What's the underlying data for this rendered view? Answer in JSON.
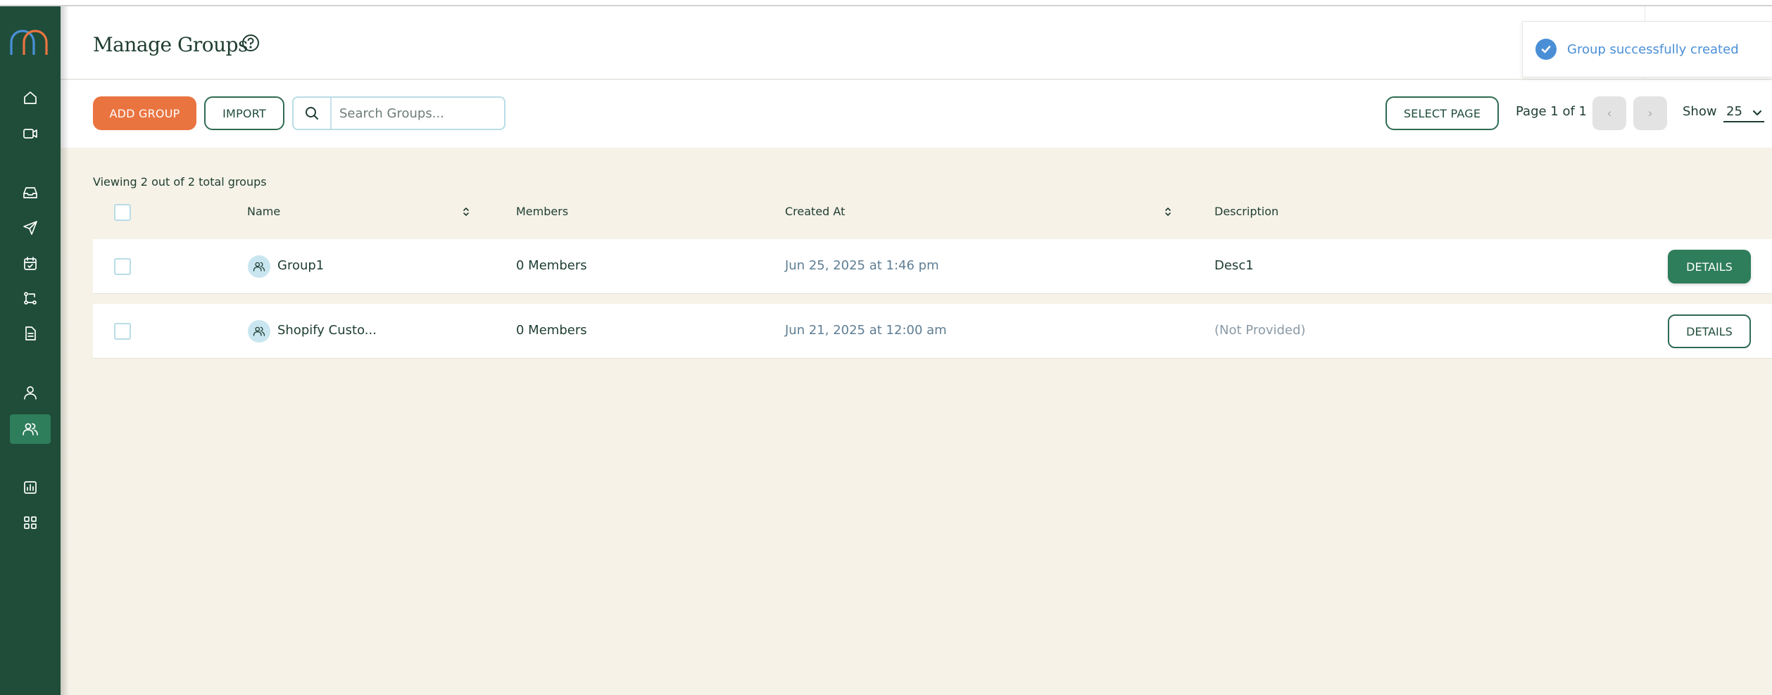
{
  "header": {
    "title": "Manage Groups"
  },
  "toast": {
    "message": "Group successfully created"
  },
  "toolbar": {
    "add_group_label": "ADD GROUP",
    "import_label": "IMPORT",
    "search_placeholder": "Search Groups...",
    "search_value": "",
    "select_page_label": "SELECT PAGE",
    "page_label": "Page 1 of 1",
    "prev_label": "‹",
    "next_label": "›",
    "show_label": "Show",
    "show_value": "25"
  },
  "summary": {
    "viewing_text": "Viewing 2 out of 2 total groups"
  },
  "table": {
    "columns": {
      "name": "Name",
      "members": "Members",
      "created_at": "Created At",
      "description": "Description"
    },
    "rows": [
      {
        "name": "Group1",
        "members": "0 Members",
        "created_at": "Jun 25, 2025 at 1:46 pm",
        "description": "Desc1",
        "action": "DETAILS"
      },
      {
        "name": "Shopify Custo...",
        "members": "0 Members",
        "created_at": "Jun 21, 2025 at 12:00 am",
        "description": "(Not Provided)",
        "action": "DETAILS"
      }
    ]
  },
  "sidebar": {
    "items": [
      {
        "icon": "home-icon"
      },
      {
        "icon": "video-icon"
      },
      {
        "icon": "inbox-icon"
      },
      {
        "icon": "send-icon"
      },
      {
        "icon": "calendar-icon"
      },
      {
        "icon": "workflow-icon"
      },
      {
        "icon": "document-icon"
      },
      {
        "icon": "user-icon"
      },
      {
        "icon": "users-icon",
        "active": true
      },
      {
        "icon": "chart-icon"
      },
      {
        "icon": "apps-grid-icon"
      }
    ]
  },
  "colors": {
    "sidebar": "#1f4d3a",
    "accent_orange": "#ea7440",
    "accent_green": "#2e7d5b",
    "toast_blue": "#4a8fd6",
    "content_bg": "#f6f2e8"
  }
}
